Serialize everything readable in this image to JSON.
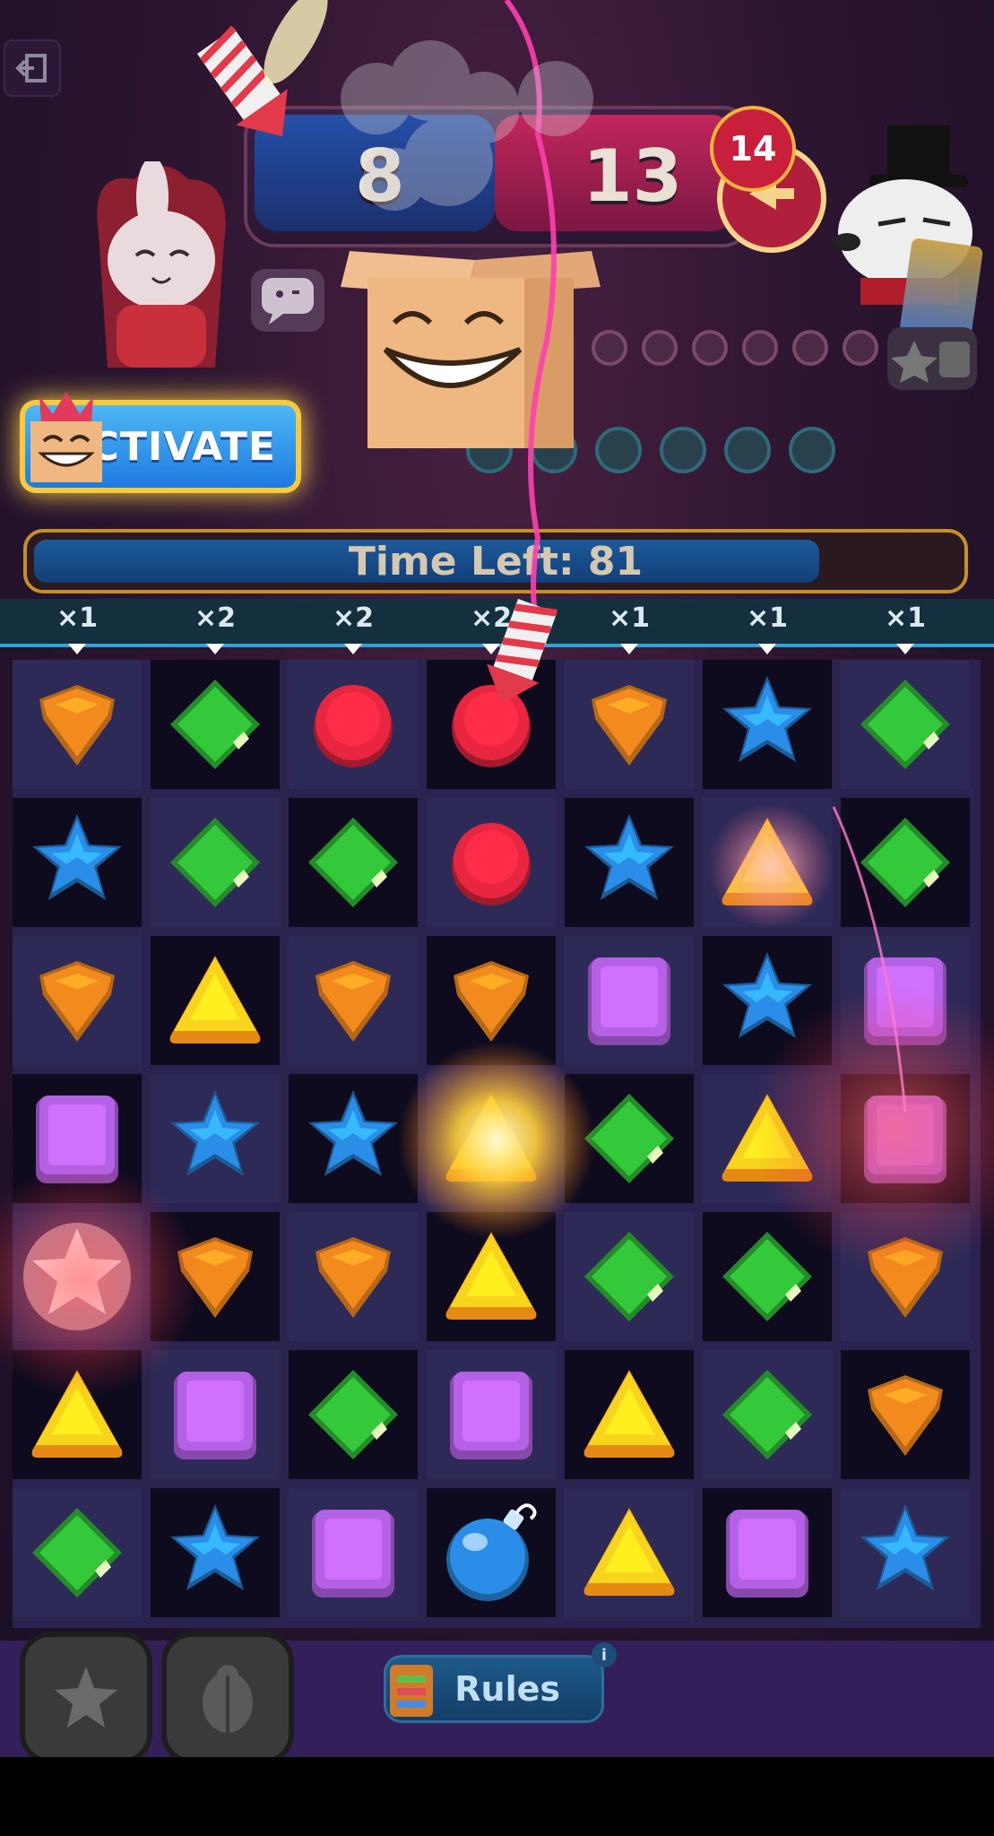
{
  "hud": {
    "score_left": "8",
    "score_right": "13",
    "moves_left": "14"
  },
  "activate": {
    "label": "ACTIVATE"
  },
  "timer": {
    "label": "Time Left: 81",
    "fraction": 0.85
  },
  "multipliers": [
    "×1",
    "×2",
    "×2",
    "×2",
    "×1",
    "×1",
    "×1"
  ],
  "board": [
    [
      "orange-gem",
      "green-gem",
      "red-gem",
      "red-gem",
      "orange-gem",
      "blue-star",
      "green-gem"
    ],
    [
      "blue-star",
      "green-gem",
      "green-gem",
      "red-gem",
      "blue-star",
      "yellow-triangle",
      "green-gem"
    ],
    [
      "orange-gem",
      "yellow-triangle",
      "orange-gem",
      "orange-gem",
      "purple-square",
      "blue-star",
      "purple-square"
    ],
    [
      "purple-square",
      "blue-star",
      "blue-star",
      "yellow-triangle",
      "green-gem",
      "yellow-triangle",
      "purple-square"
    ],
    [
      "white-star",
      "orange-gem",
      "orange-gem",
      "yellow-triangle",
      "green-gem",
      "green-gem",
      "orange-gem"
    ],
    [
      "yellow-triangle",
      "purple-square",
      "green-gem",
      "purple-square",
      "yellow-triangle",
      "green-gem",
      "orange-gem"
    ],
    [
      "green-gem",
      "blue-star",
      "purple-square",
      "blue-bomb",
      "yellow-triangle",
      "purple-square",
      "blue-star"
    ]
  ],
  "bottom": {
    "rules_label": "Rules",
    "info": "i"
  },
  "colors": {
    "orange": "#f28a1e",
    "green": "#34c93a",
    "red": "#e8263f",
    "blue": "#2a8ee8",
    "yellow": "#f7d51c",
    "purple": "#b561e6"
  }
}
